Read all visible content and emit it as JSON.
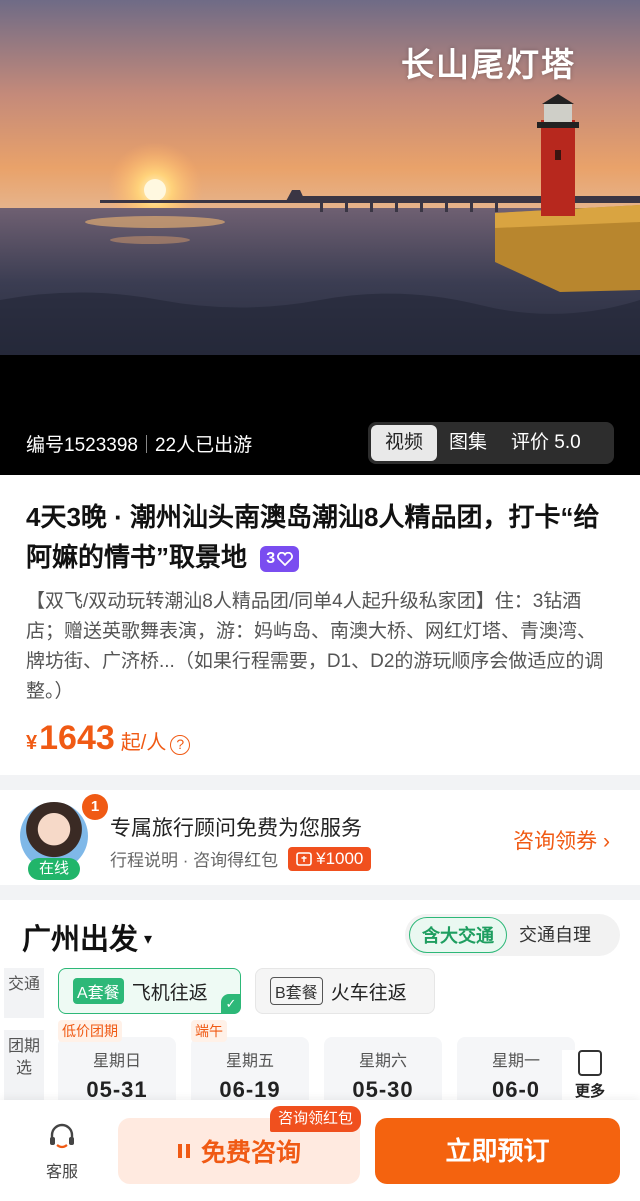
{
  "hero": {
    "overlay_title": "长山尾灯塔",
    "code": "编号1523398",
    "travelers": "22人已出游",
    "media_tabs": [
      {
        "label": "视频",
        "active": true
      },
      {
        "label": "图集",
        "active": false
      },
      {
        "label": "评价 5.0",
        "active": false
      }
    ]
  },
  "product": {
    "title": "4天3晚 · 潮州汕头南澳岛潮汕8人精品团，打卡“给阿嫲的情书”取景地",
    "badge": "3",
    "description": "【双飞/双动玩转潮汕8人精品团/同单4人起升级私家团】住：3钻酒店；赠送英歌舞表演，游：妈屿岛、南澳大桥、网红灯塔、青澳湾、牌坊街、广济桥...（如果行程需要，D1、D2的游玩顺序会做适应的调整。）",
    "price_currency": "¥",
    "price": "1643",
    "price_unit": "起/人",
    "price_help": "?"
  },
  "advisor": {
    "badge_count": "1",
    "status": "在线",
    "title": "专属旅行顾问免费为您服务",
    "subtitle": "行程说明 · 咨询得红包",
    "red_packet": "¥1000",
    "link": "咨询领券 ›"
  },
  "departure": {
    "city": "广州出发",
    "caret": "▾",
    "transport_options": [
      {
        "label": "含大交通",
        "active": true
      },
      {
        "label": "交通自理",
        "active": false
      }
    ],
    "transport_label": "交通",
    "packages": [
      {
        "tag": "A套餐",
        "label": "飞机往返",
        "selected": true
      },
      {
        "tag": "B套餐",
        "label": "火车往返",
        "selected": false
      }
    ],
    "date_label": "团期选",
    "dates": [
      {
        "weekday": "星期日",
        "date": "05-31",
        "tag": "低价团期"
      },
      {
        "weekday": "星期五",
        "date": "06-19",
        "tag": "端午"
      },
      {
        "weekday": "星期六",
        "date": "05-30",
        "tag": ""
      },
      {
        "weekday": "星期一",
        "date": "06-0",
        "tag": ""
      }
    ],
    "more_label": "更多"
  },
  "bottom": {
    "service_label": "客服",
    "consult_tag": "咨询领红包",
    "consult_label": "免费咨询",
    "book_label": "立即预订"
  },
  "colors": {
    "accent": "#f05a14",
    "green": "#2db878",
    "purple": "#7a4df0"
  }
}
